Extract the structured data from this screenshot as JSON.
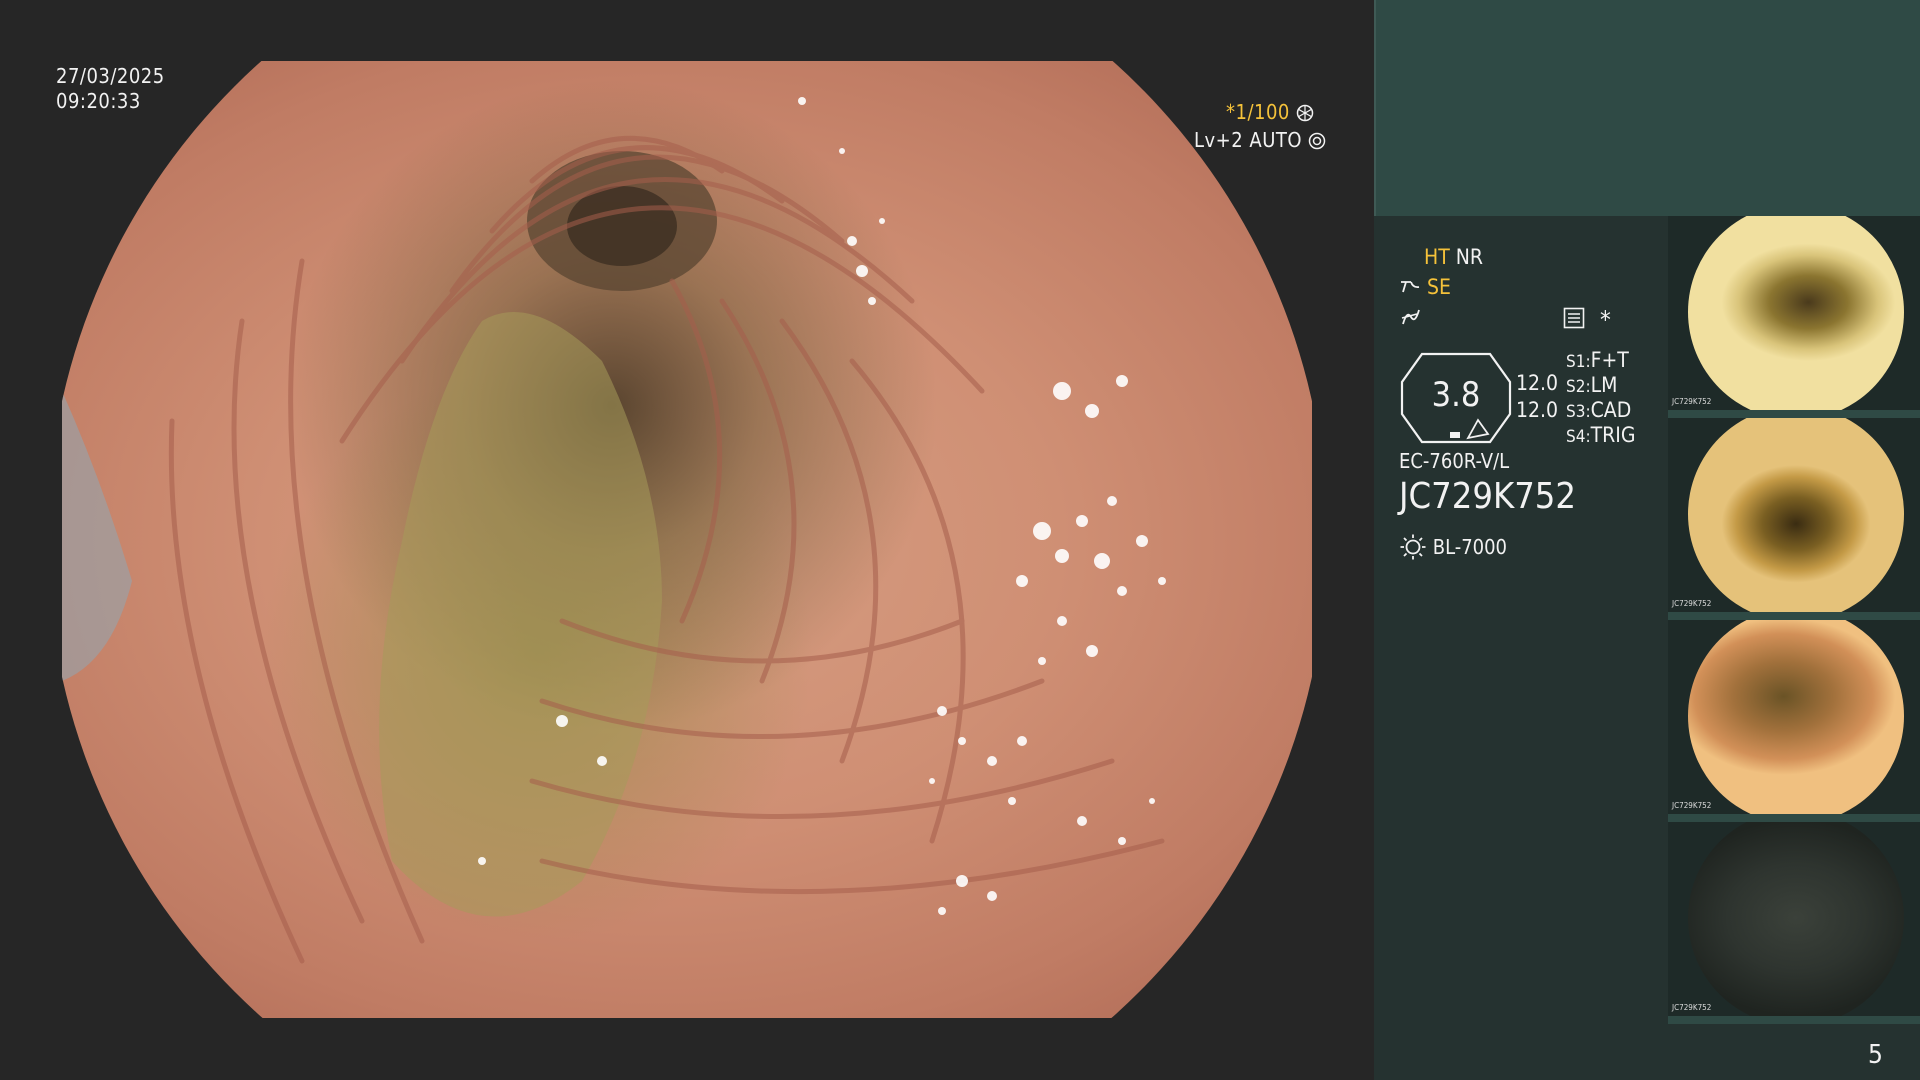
{
  "overlay": {
    "date": "27/03/2025",
    "time": "09:20:33",
    "shutter": "*1/100",
    "shutter_icon": "aperture-icon",
    "level": "Lv+2",
    "mode": "AUTO",
    "mode_icon": "iris-icon"
  },
  "panel": {
    "ht": "HT",
    "nr": "NR",
    "se": "SE",
    "zoom_value": "3.8",
    "value_1": "12.0",
    "value_2": "12.0",
    "s1_label": "S1:",
    "s1_value": "F+T",
    "s2_label": "S2:",
    "s2_value": "LM",
    "s3_label": "S3:",
    "s3_value": "CAD",
    "s4_label": "S4:",
    "s4_value": "TRIG",
    "scope_model": "EC-760R-V/L",
    "scope_serial": "JC729K752",
    "light_source": "BL-7000",
    "star": "*",
    "page_number": "5"
  },
  "thumbnails": [
    {
      "serial": "JC729K752",
      "bg": "#7a6a25",
      "accent": "#e6c66a"
    },
    {
      "serial": "JC729K752",
      "bg": "#6f5a1e",
      "accent": "#cfa64a"
    },
    {
      "serial": "JC729K752",
      "bg": "#8a5a30",
      "accent": "#d8a060"
    },
    {
      "serial": "JC729K752",
      "bg": "#2a302b",
      "accent": "#4a4f46"
    }
  ],
  "colors": {
    "accent_yellow": "#f5c23a",
    "panel_top": "#2f4a45",
    "panel": "#253230",
    "background": "#262626",
    "mucosa": "#cf8f74"
  }
}
